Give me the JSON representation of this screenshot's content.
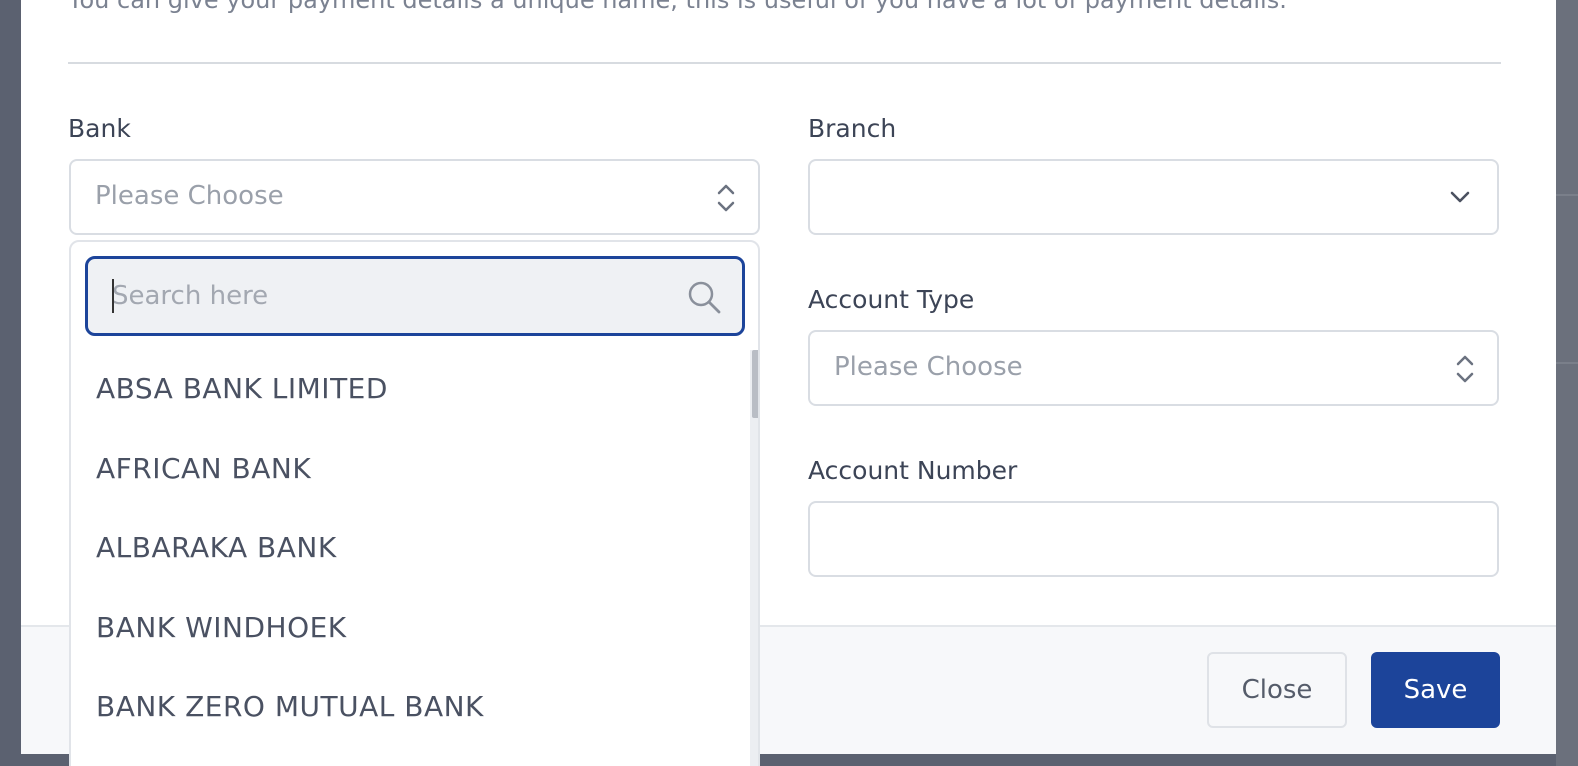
{
  "modal": {
    "intro": "You can give your payment details a unique name, this is useful of you have a lot of payment details."
  },
  "fields": {
    "bank": {
      "label": "Bank",
      "placeholder": "Please Choose"
    },
    "branch": {
      "label": "Branch",
      "value": ""
    },
    "account_type": {
      "label": "Account Type",
      "placeholder": "Please Choose"
    },
    "account_number": {
      "label": "Account Number",
      "value": ""
    }
  },
  "dropdown": {
    "search_placeholder": "Search here",
    "options": [
      "ABSA BANK LIMITED",
      "AFRICAN BANK",
      "ALBARAKA BANK",
      "BANK WINDHOEK",
      "BANK ZERO MUTUAL BANK"
    ]
  },
  "footer": {
    "close_label": "Close",
    "save_label": "Save"
  },
  "colors": {
    "primary": "#1c449a",
    "overlay": "#5b6170"
  }
}
